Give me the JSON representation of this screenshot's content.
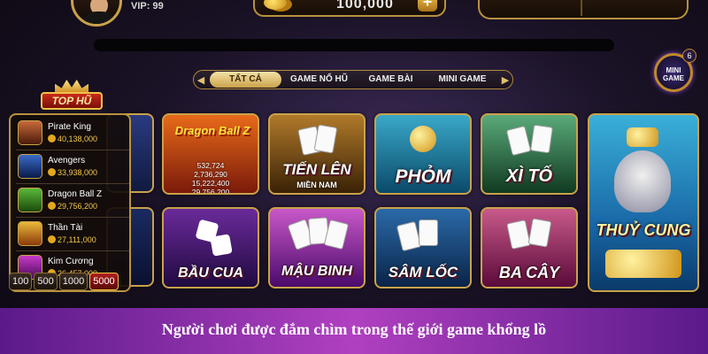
{
  "header": {
    "vip_label": "VIP: 99",
    "balance": "100,000",
    "add_icon": "plus-icon"
  },
  "tabs": {
    "items": [
      {
        "label": "TẤT CẢ",
        "active": true
      },
      {
        "label": "GAME NỔ HŨ",
        "active": false
      },
      {
        "label": "GAME BÀI",
        "active": false
      },
      {
        "label": "MINI GAME",
        "active": false
      }
    ]
  },
  "mini_game": {
    "label_line1": "MINI",
    "label_line2": "GAME",
    "badge": "6"
  },
  "top_hu": {
    "title": "TOP HŨ",
    "jackpots": [
      {
        "name": "Pirate King",
        "amount": "40,138,000"
      },
      {
        "name": "Avengers",
        "amount": "33,938,000"
      },
      {
        "name": "Dragon Ball Z",
        "amount": "29,756,200"
      },
      {
        "name": "Thần Tài",
        "amount": "27,111,000"
      },
      {
        "name": "Kim Cương",
        "amount": "26,457,000"
      }
    ],
    "bets": [
      {
        "label": "100",
        "active": false
      },
      {
        "label": "500",
        "active": false
      },
      {
        "label": "1000",
        "active": false
      },
      {
        "label": "5000",
        "active": true
      }
    ]
  },
  "games": {
    "dragon_ball": {
      "logo": "Dragon Ball Z",
      "jackpots": [
        "532,724",
        "2,736,290",
        "15,222,400",
        "29,756,200"
      ]
    },
    "tien_len": {
      "title": "TIẾN LÊN",
      "subtitle": "MIỀN NAM"
    },
    "phom": {
      "title": "PHỎM"
    },
    "xi_to": {
      "title": "XÌ TỐ"
    },
    "thuy_cung": {
      "title": "THUỶ CUNG"
    },
    "bau_cua": {
      "title": "BẦU CUA"
    },
    "mau_binh": {
      "title": "MẬU BINH"
    },
    "sam_loc": {
      "title": "SÂM LỐC"
    },
    "ba_cay": {
      "title": "BA CÂY"
    }
  },
  "caption": "Người chơi được đắm chìm trong thế giới game khổng lồ",
  "colors": {
    "gold": "#c9a24a",
    "caption_purple": "#b040c0",
    "jackpot_yellow": "#f4c84a"
  }
}
